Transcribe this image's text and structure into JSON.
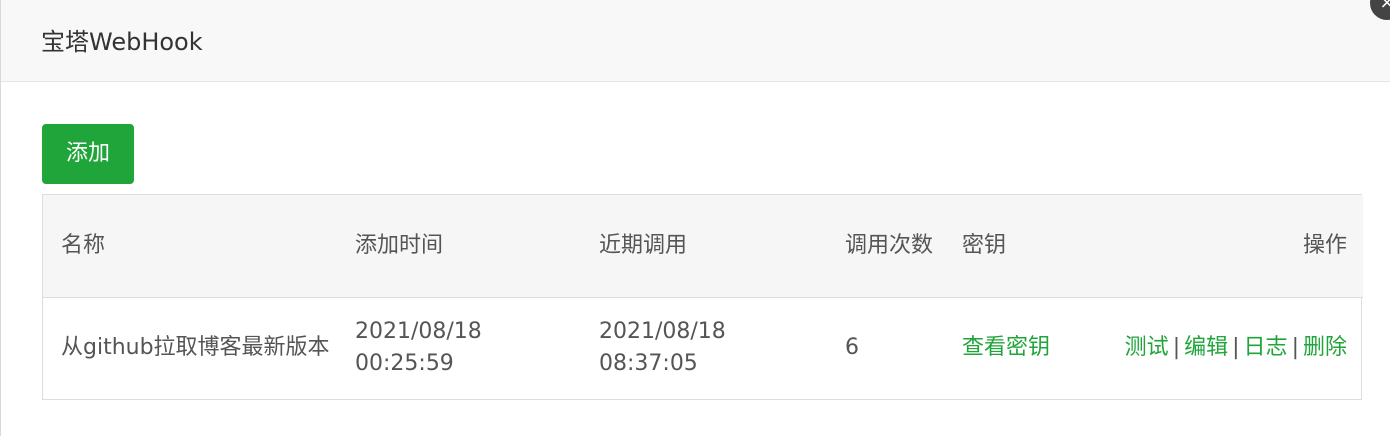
{
  "dialog": {
    "title": "宝塔WebHook",
    "close_icon": "close-icon"
  },
  "toolbar": {
    "add_label": "添加"
  },
  "table": {
    "columns": {
      "name": "名称",
      "added_time": "添加时间",
      "last_called": "近期调用",
      "call_count": "调用次数",
      "key": "密钥",
      "operations": "操作"
    },
    "rows": [
      {
        "name": "从github拉取博客最新版本",
        "added_time": "2021/08/18 00:25:59",
        "last_called": "2021/08/18 08:37:05",
        "call_count": "6",
        "key_action": "查看密钥",
        "actions": {
          "test": "测试",
          "edit": "编辑",
          "log": "日志",
          "delete": "删除",
          "separator": "|"
        }
      }
    ]
  },
  "colors": {
    "accent": "#20a53a",
    "text": "#555555",
    "header_bg": "#f8f8f8"
  }
}
